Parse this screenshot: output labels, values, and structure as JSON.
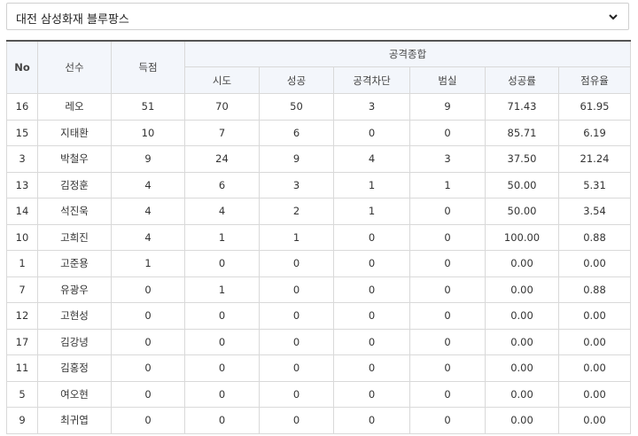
{
  "team_select": {
    "selected": "대전 삼성화재 블루팡스"
  },
  "table": {
    "headers": {
      "no": "No",
      "player": "선수",
      "points": "득점",
      "group": "공격종합",
      "sub": [
        "시도",
        "성공",
        "공격차단",
        "범실",
        "성공률",
        "점유율"
      ]
    },
    "rows": [
      [
        "16",
        "레오",
        "51",
        "70",
        "50",
        "3",
        "9",
        "71.43",
        "61.95"
      ],
      [
        "15",
        "지태환",
        "10",
        "7",
        "6",
        "0",
        "0",
        "85.71",
        "6.19"
      ],
      [
        "3",
        "박철우",
        "9",
        "24",
        "9",
        "4",
        "3",
        "37.50",
        "21.24"
      ],
      [
        "13",
        "김정훈",
        "4",
        "6",
        "3",
        "1",
        "1",
        "50.00",
        "5.31"
      ],
      [
        "14",
        "석진욱",
        "4",
        "4",
        "2",
        "1",
        "0",
        "50.00",
        "3.54"
      ],
      [
        "10",
        "고희진",
        "4",
        "1",
        "1",
        "0",
        "0",
        "100.00",
        "0.88"
      ],
      [
        "1",
        "고준용",
        "1",
        "0",
        "0",
        "0",
        "0",
        "0.00",
        "0.00"
      ],
      [
        "7",
        "유광우",
        "0",
        "1",
        "0",
        "0",
        "0",
        "0.00",
        "0.88"
      ],
      [
        "12",
        "고현성",
        "0",
        "0",
        "0",
        "0",
        "0",
        "0.00",
        "0.00"
      ],
      [
        "17",
        "김강녕",
        "0",
        "0",
        "0",
        "0",
        "0",
        "0.00",
        "0.00"
      ],
      [
        "11",
        "김홍정",
        "0",
        "0",
        "0",
        "0",
        "0",
        "0.00",
        "0.00"
      ],
      [
        "5",
        "여오현",
        "0",
        "0",
        "0",
        "0",
        "0",
        "0.00",
        "0.00"
      ],
      [
        "9",
        "최귀엽",
        "0",
        "0",
        "0",
        "0",
        "0",
        "0.00",
        "0.00"
      ]
    ]
  }
}
